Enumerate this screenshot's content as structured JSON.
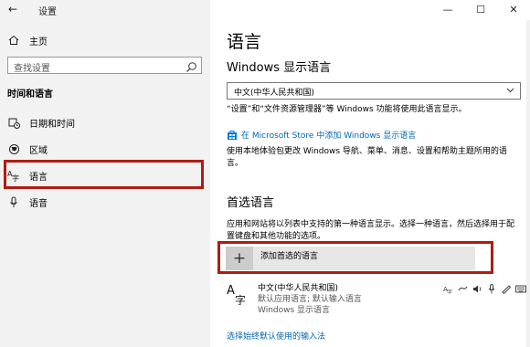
{
  "window": {
    "title": "设置",
    "back_icon": "←",
    "minimize": "—",
    "maximize": "☐",
    "close": "✕"
  },
  "sidebar": {
    "home_label": "主页",
    "search_placeholder": "查找设置",
    "section_title": "时间和语言",
    "items": [
      {
        "label": "日期和时间",
        "icon": "calendar-clock-icon"
      },
      {
        "label": "区域",
        "icon": "globe-region-icon"
      },
      {
        "label": "语言",
        "icon": "language-icon"
      },
      {
        "label": "语音",
        "icon": "microphone-icon"
      }
    ]
  },
  "main": {
    "title": "语言",
    "display_language_heading": "Windows 显示语言",
    "display_language_value": "中文(中华人民共和国)",
    "display_language_desc": "“设置”和“文件资源管理器”等 Windows 功能将使用此语言显示。",
    "store_link": "在 Microsoft Store 中添加 Windows 显示语言",
    "local_pack_desc": "使用本地体验包更改 Windows 导航、菜单、消息、设置和帮助主题所用的语言。",
    "preferred_heading": "首选语言",
    "preferred_desc": "应用和网站将以列表中支持的第一种语言显示。选择一种语言，然后选择用于配置键盘和其他功能的选项。",
    "add_language_label": "添加首选的语言",
    "language_item": {
      "name": "中文(中华人民共和国)",
      "sub1": "默认应用语言; 默认输入语言",
      "sub2": "Windows 显示语言"
    },
    "bottom_link": "选择始终默认使用的输入法"
  },
  "colors": {
    "highlight": "#b01c12",
    "link": "#0066b4",
    "sidebar_bg": "#f2f2f2"
  }
}
